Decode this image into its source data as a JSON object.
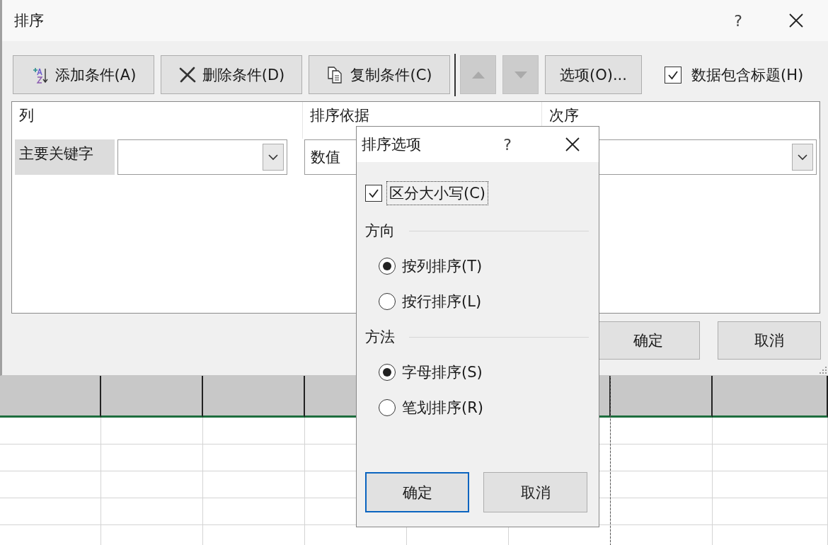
{
  "window": {
    "title": "排序",
    "help": "?"
  },
  "toolbar": {
    "buttons": [
      {
        "kind": "add",
        "label": "添加条件(A)"
      },
      {
        "kind": "delete",
        "label": "删除条件(D)"
      },
      {
        "kind": "copy",
        "label": "复制条件(C)"
      }
    ],
    "move_up": {
      "disabled": true
    },
    "move_down": {
      "disabled": true
    },
    "options": {
      "label": "选项(O)..."
    },
    "has_headers": {
      "label": "数据包含标题(H)",
      "checked": true
    }
  },
  "conditions": {
    "columns": [
      "列",
      "排序依据",
      "次序"
    ],
    "rows": [
      {
        "label": "主要关键字",
        "sort_on": "数值"
      }
    ]
  },
  "buttons": [
    {
      "label": "确定"
    },
    {
      "label": "取消"
    }
  ],
  "options_dialog": {
    "title": "排序选项",
    "help": "?",
    "case_sensitive": {
      "label": "区分大小写(C)",
      "checked": true,
      "focused": true
    },
    "groups": [
      {
        "title": "方向",
        "options": [
          {
            "label": "按列排序(T)",
            "selected": true
          },
          {
            "label": "按行排序(L)",
            "selected": false
          }
        ]
      },
      {
        "title": "方法",
        "options": [
          {
            "label": "字母排序(S)",
            "selected": true
          },
          {
            "label": "笔划排序(R)",
            "selected": false
          }
        ]
      }
    ],
    "buttons": [
      {
        "label": "确定",
        "default": true
      },
      {
        "label": "取消",
        "default": false
      }
    ]
  }
}
